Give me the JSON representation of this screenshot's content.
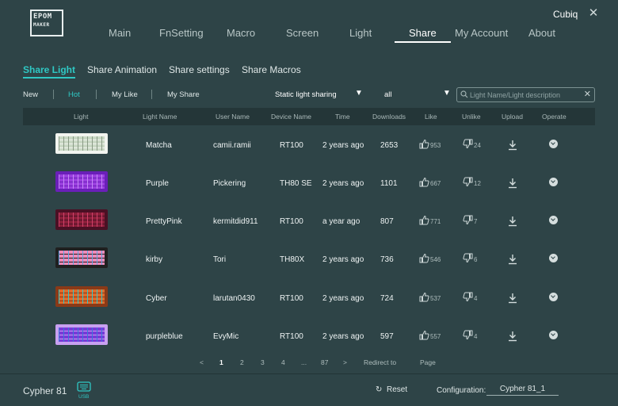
{
  "header": {
    "logo_line1": "EPOM",
    "logo_line2": "MAKER",
    "account_name": "Cubiq",
    "close_symbol": "✕",
    "nav": [
      "Main",
      "FnSetting",
      "Macro",
      "Screen",
      "Light",
      "Share",
      "My Account",
      "About"
    ],
    "active_nav": "Share"
  },
  "subtabs": [
    "Share Light",
    "Share Animation",
    "Share settings",
    "Share Macros"
  ],
  "active_subtab": "Share Light",
  "filters": {
    "tabs": [
      "New",
      "Hot",
      "My Like",
      "My Share"
    ],
    "active": "Hot",
    "type_select": "Static light sharing",
    "scope_select": "all",
    "search_placeholder": "Light Name/Light description"
  },
  "table": {
    "headers": [
      "Light",
      "Light Name",
      "User Name",
      "Device Name",
      "Time",
      "Downloads",
      "Like",
      "Unlike",
      "Upload",
      "Operate"
    ],
    "rows": [
      {
        "name": "Matcha",
        "user": "camii.ramii",
        "device": "RT100",
        "time": "2 years ago",
        "downloads": "2653",
        "like": "953",
        "unlike": "24",
        "thumb_colors": [
          "#c9d8c4",
          "#8a9b86",
          "#f2f4ef"
        ]
      },
      {
        "name": "Purple",
        "user": "Pickering",
        "device": "TH80 SE",
        "time": "2 years ago",
        "downloads": "1101",
        "like": "667",
        "unlike": "12",
        "thumb_colors": [
          "#9b3fe0",
          "#c58af5",
          "#6a1fb8"
        ]
      },
      {
        "name": "PrettyPink",
        "user": "kermitdid911",
        "device": "RT100",
        "time": "a year ago",
        "downloads": "807",
        "like": "771",
        "unlike": "7",
        "thumb_colors": [
          "#8a1f3a",
          "#d0406a",
          "#4a1024"
        ]
      },
      {
        "name": "kirby",
        "user": "Tori",
        "device": "TH80X",
        "time": "2 years ago",
        "downloads": "736",
        "like": "546",
        "unlike": "6",
        "thumb_colors": [
          "#f08ab8",
          "#5fa8e8",
          "#202020"
        ]
      },
      {
        "name": "Cyber",
        "user": "larutan0430",
        "device": "RT100",
        "time": "2 years ago",
        "downloads": "724",
        "like": "537",
        "unlike": "4",
        "thumb_colors": [
          "#e06a2a",
          "#30c8c8",
          "#8a3a18"
        ]
      },
      {
        "name": "purpleblue",
        "user": "EvyMic",
        "device": "RT100",
        "time": "2 years ago",
        "downloads": "597",
        "like": "557",
        "unlike": "4",
        "thumb_colors": [
          "#7a3ad8",
          "#3a7ad8",
          "#c8a0f0"
        ]
      }
    ]
  },
  "pagination": {
    "prev": "<",
    "pages": [
      "1",
      "2",
      "3",
      "4",
      "...",
      "87"
    ],
    "current": "1",
    "next": ">",
    "redirect_label": "Redirect to",
    "page_label": "Page"
  },
  "footer": {
    "device_name": "Cypher 81",
    "usb_label": "USB",
    "reset_label": "Reset",
    "config_label": "Configuration:",
    "config_value": "Cypher 81_1"
  },
  "colors": {
    "background": "#2e4447",
    "accent": "#2fc8c4",
    "table_header": "#243638"
  },
  "icons": [
    "logo",
    "close-icon",
    "search-icon",
    "clear-icon",
    "thumbs-up-icon",
    "thumbs-down-icon",
    "download-icon",
    "chevron-down-icon",
    "usb-keyboard-icon",
    "reset-icon"
  ]
}
